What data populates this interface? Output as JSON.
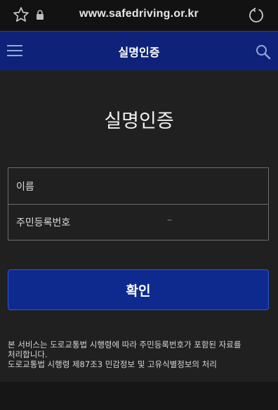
{
  "browser": {
    "url": "www.safedriving.or.kr",
    "icons": [
      "star-icon",
      "lock-icon",
      "reload-icon"
    ]
  },
  "appbar": {
    "title": "실명인증",
    "icons": [
      "menu-icon",
      "search-icon"
    ]
  },
  "main": {
    "title": "실명인증",
    "form": {
      "name_label": "이름",
      "id_label": "주민등록번호",
      "id_separator": "–"
    },
    "confirm_label": "확인",
    "notice_line1": "본 서비스는 도로교통법 시행령에 따라 주민등록번호가 포함된 자료를",
    "notice_line2": "처리합니다.",
    "notice_line3": "도로교통법 시행령 제87조3 민감정보 및 고유식별정보의 처리"
  },
  "colors": {
    "appbar": "#0d2278",
    "button": "#0e2a8f",
    "button_border": "#2f56d8",
    "background": "#202020"
  }
}
